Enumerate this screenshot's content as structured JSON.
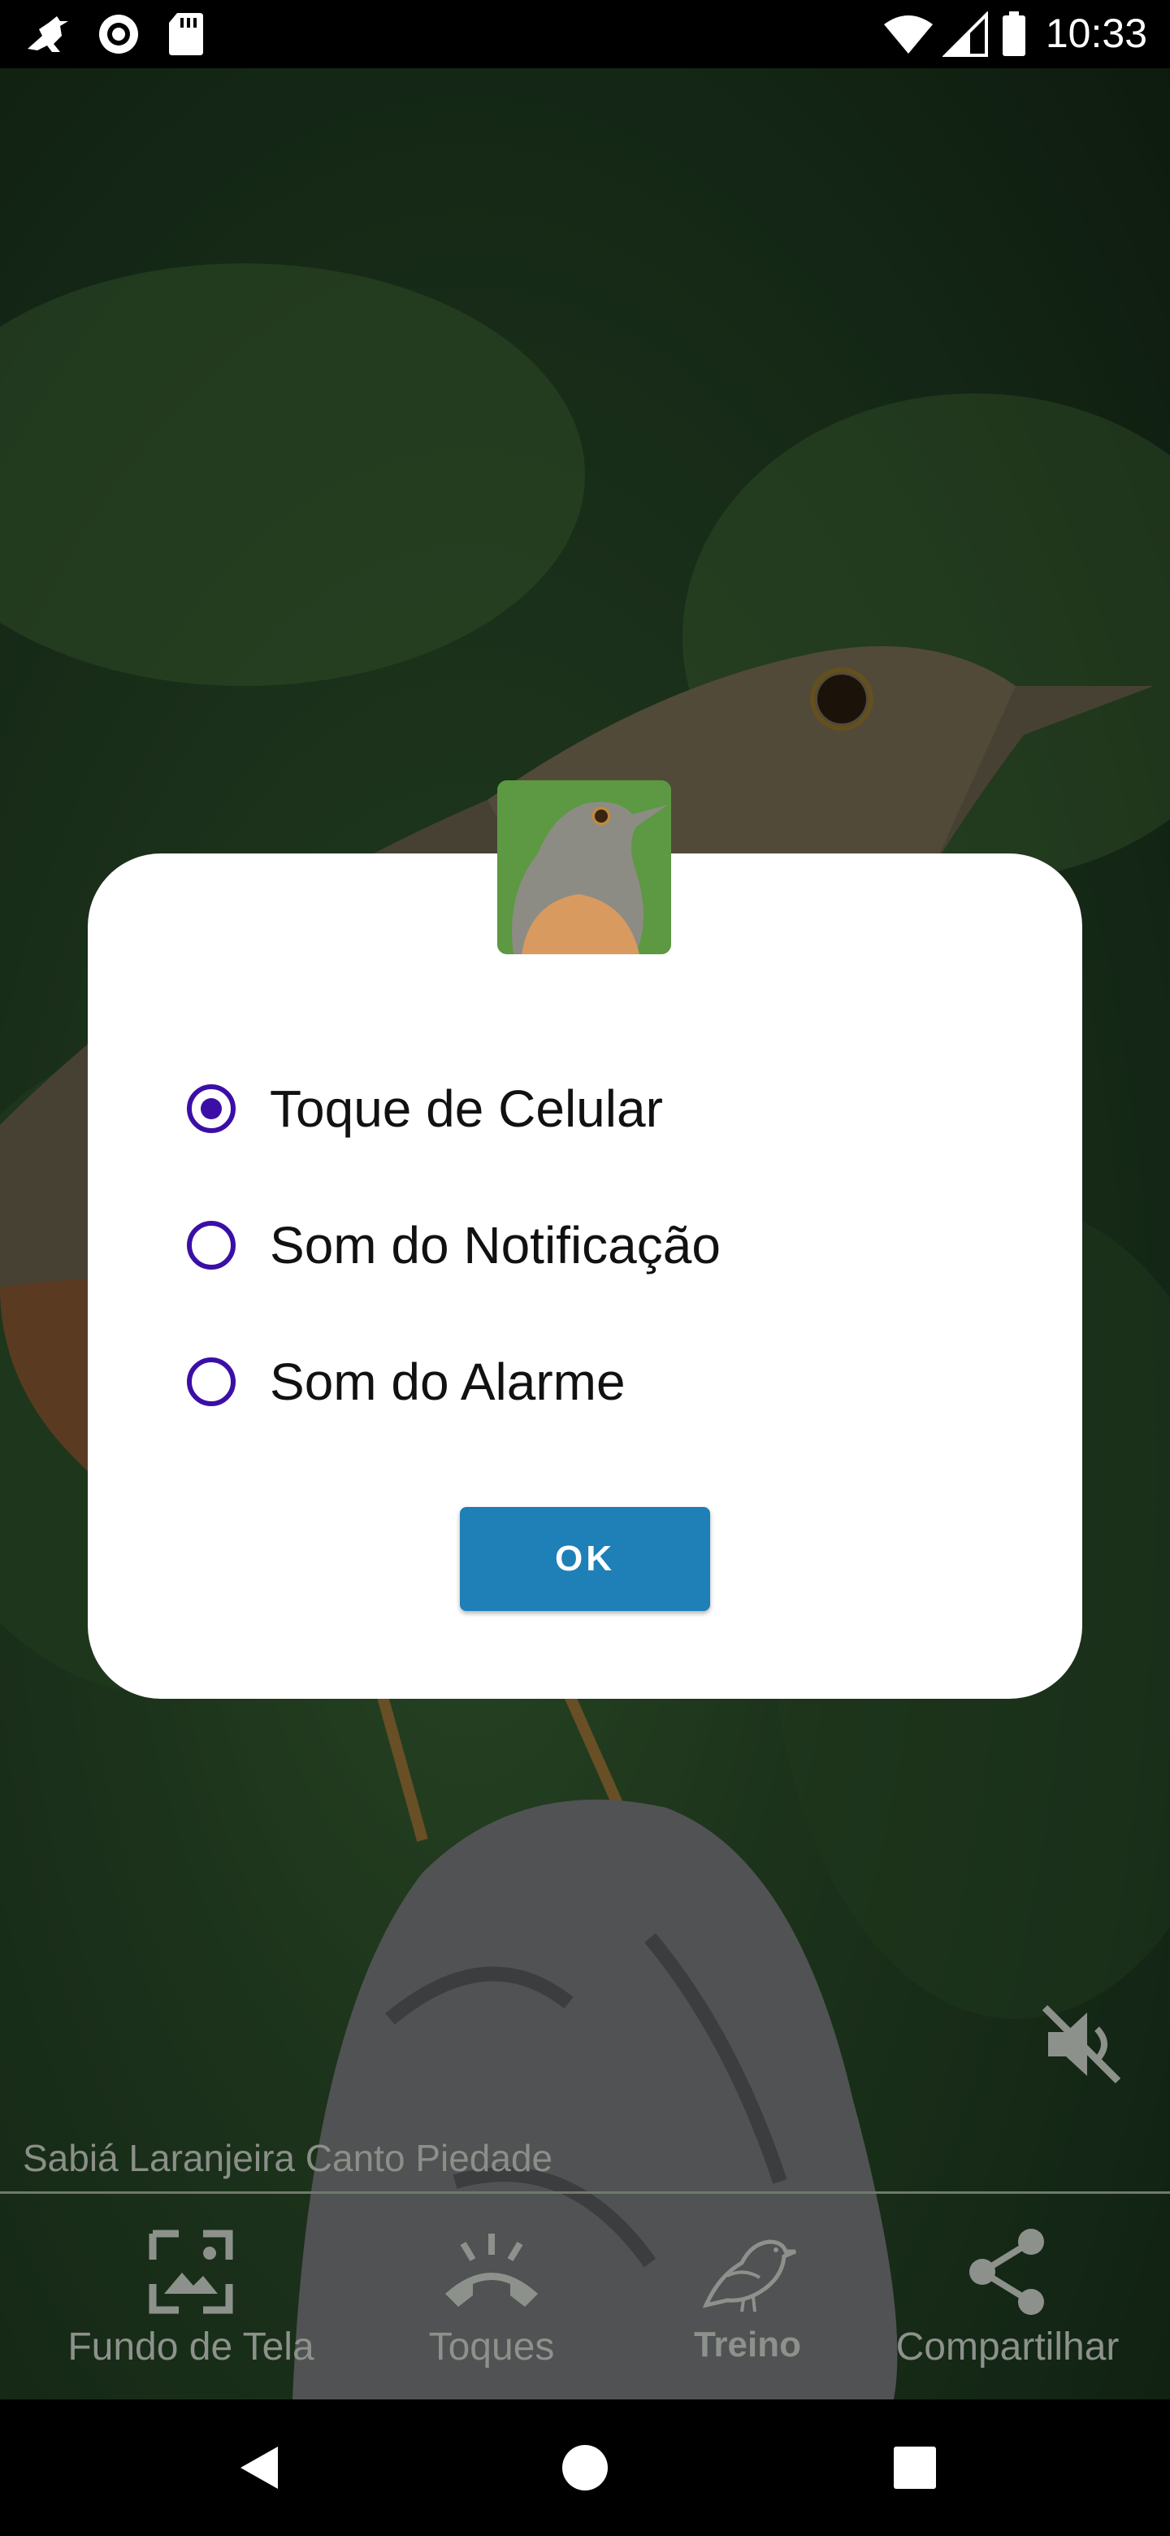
{
  "status_bar": {
    "time": "10:33",
    "icons": [
      "bird-notification-icon",
      "record-icon",
      "sd-card-icon",
      "wifi-icon",
      "signal-icon",
      "battery-icon"
    ]
  },
  "dialog": {
    "options": [
      {
        "label": "Toque de Celular",
        "selected": true
      },
      {
        "label": "Som do Notificação",
        "selected": false
      },
      {
        "label": "Som do Alarme",
        "selected": false
      }
    ],
    "ok_label": "OK",
    "accent_color": "#3b0fa6",
    "button_color": "#1e80b6"
  },
  "player": {
    "caption": "Sabiá Laranjeira Canto Piedade",
    "mute_icon": "volume-off-icon"
  },
  "bottom_nav": {
    "items": [
      {
        "label": "Fundo de Tela",
        "icon": "wallpaper-icon",
        "active": false
      },
      {
        "label": "Toques",
        "icon": "ringtone-icon",
        "active": false
      },
      {
        "label": "Treino",
        "icon": "bird-icon",
        "active": true
      },
      {
        "label": "Compartilhar",
        "icon": "share-icon",
        "active": false
      }
    ]
  },
  "android_nav": {
    "icons": [
      "back-icon",
      "home-icon",
      "recents-icon"
    ]
  }
}
